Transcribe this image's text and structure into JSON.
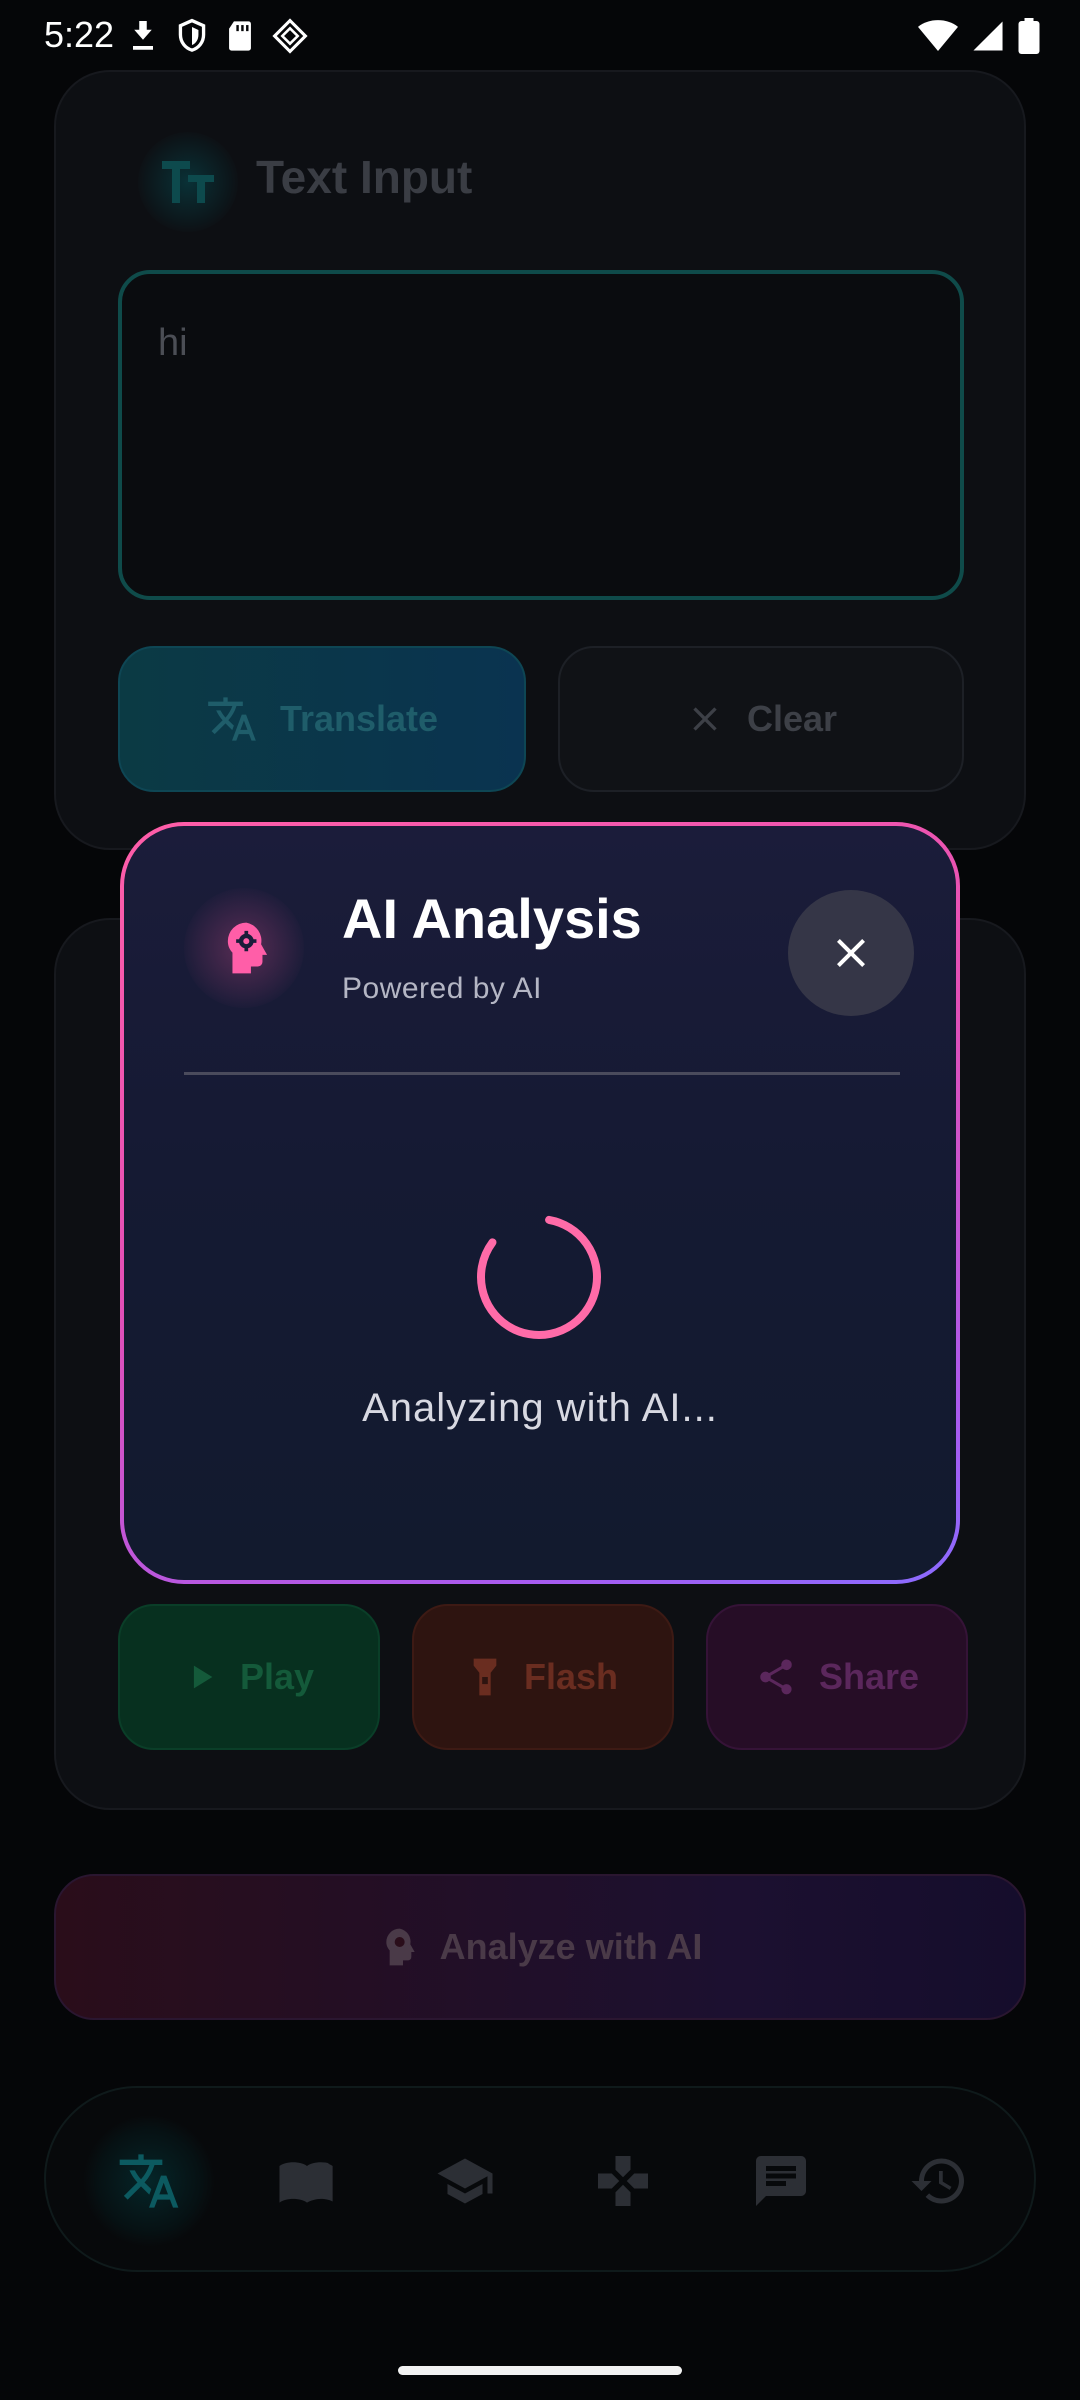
{
  "status_bar": {
    "time": "5:22",
    "left_icons": [
      "download-icon",
      "shield-icon",
      "sd-card-icon",
      "vpn-diamond-icon"
    ],
    "right_icons": [
      "wifi-icon",
      "signal-icon",
      "battery-icon"
    ]
  },
  "text_card": {
    "title": "Text Input",
    "icon": "text-format-icon",
    "input_value": "hi",
    "translate_label": "Translate",
    "clear_label": "Clear"
  },
  "output_card": {
    "play_label": "Play",
    "flash_label": "Flash",
    "share_label": "Share"
  },
  "analyze_button": {
    "label": "Analyze with AI",
    "icon": "brain-head-icon"
  },
  "bottom_nav": {
    "items": [
      "translate-icon",
      "book-icon",
      "school-icon",
      "gamepad-icon",
      "chat-icon",
      "history-icon"
    ],
    "active_index": 0
  },
  "modal": {
    "title": "AI Analysis",
    "subtitle": "Powered by AI",
    "loading_text": "Analyzing with AI...",
    "accent_color": "#ff5ea8",
    "gradient_end_color": "#8a6cff"
  }
}
